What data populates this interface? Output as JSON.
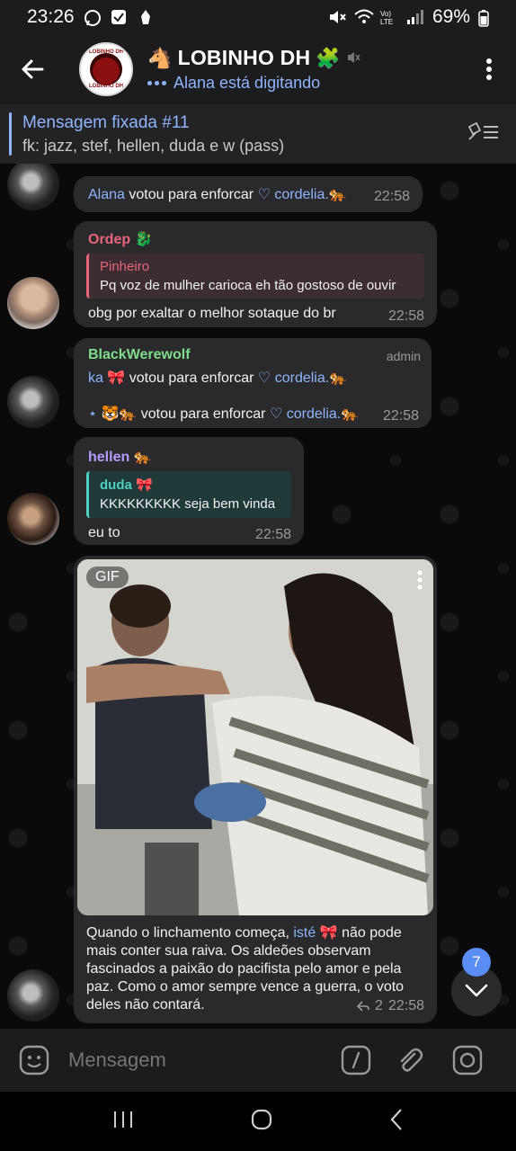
{
  "status": {
    "time": "23:26",
    "battery": "69%"
  },
  "header": {
    "title": "LOBINHO DH",
    "typing": "Alana está digitando",
    "avatar_top": "LOBINHO DH",
    "avatar_bottom": "LOBINHO DH"
  },
  "pinned": {
    "title": "Mensagem fixada #11",
    "text": "fk: jazz, stef, hellen, duda e w (pass)"
  },
  "messages": {
    "m1": {
      "voter": "Alana",
      "text": " votou para enforcar ",
      "target": "♡ cordelia.",
      "time": "22:58"
    },
    "m2": {
      "author": "Ordep",
      "quote_author": "Pinheiro",
      "quote_text": "Pq voz de mulher carioca eh tão gostoso de ouvir",
      "text": "obg por exaltar o melhor sotaque do br",
      "time": "22:58"
    },
    "m3": {
      "author": "BlackWerewolf",
      "badge": "admin",
      "line1_voter": "ka",
      "line1_text": " votou para enforcar ",
      "line1_target": "♡ cordelia.",
      "line2_voter": "⋆",
      "line2_text": " votou para enforcar ",
      "line2_target": "♡ cordelia.",
      "time": "22:58"
    },
    "m4": {
      "author": "hellen",
      "quote_author": "duda",
      "quote_text": "KKKKKKKKK seja bem vinda",
      "text": "eu to",
      "time": "22:58"
    },
    "m5": {
      "gif_label": "GIF",
      "caption_pre": "Quando o linchamento começa, ",
      "caption_mention": "isté",
      "caption_post": " não pode mais conter sua raiva. Os aldeões observam fascinados a paixão do pacifista pelo amor e pela paz. Como o amor sempre vence a guerra, o voto deles não contará.",
      "replies": "2",
      "time": "22:58"
    }
  },
  "unread_count": "7",
  "input": {
    "placeholder": "Mensagem"
  },
  "colors": {
    "accent": "#8fb5ff",
    "ordep": "#e8657a",
    "blackwerewolf": "#7fdc8a",
    "hellen": "#b59cff",
    "duda": "#4fd0c0"
  }
}
